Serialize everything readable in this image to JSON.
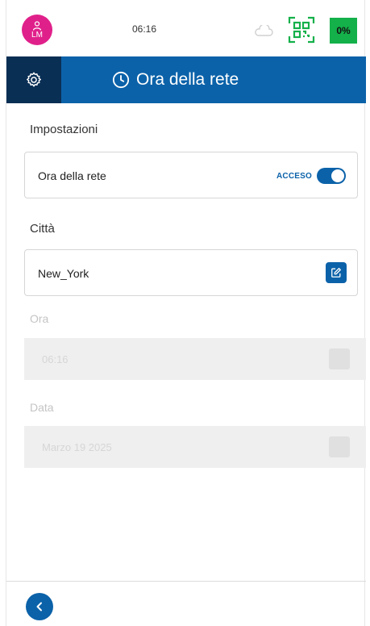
{
  "status": {
    "avatar_initials": "LM",
    "time": "06:16",
    "battery": "0%",
    "battery_color": "#14b04a",
    "avatar_color": "#e0208a"
  },
  "header": {
    "title": "Ora della rete",
    "color": "#0b62a9",
    "settings_icon": "gear-icon",
    "title_icon": "clock-icon"
  },
  "settings": {
    "section_label": "Impostazioni",
    "network_time_label": "Ora della rete",
    "toggle_state_label": "ACCESO",
    "toggle_on": true
  },
  "city": {
    "section_label": "Città",
    "value": "New_York",
    "edit_icon": "edit-icon"
  },
  "time_field": {
    "label": "Ora",
    "value": "06:16"
  },
  "date_field": {
    "label": "Data",
    "value": "Marzo 19 2025"
  },
  "footer": {
    "back_icon": "chevron-left-icon"
  }
}
